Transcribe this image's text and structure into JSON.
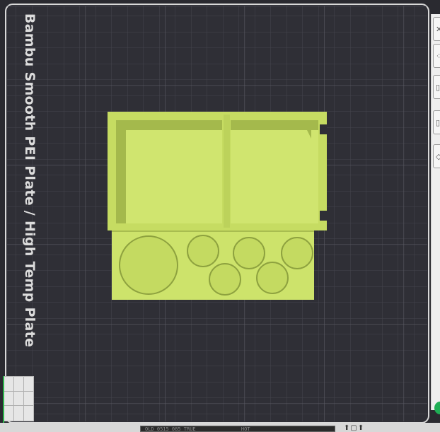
{
  "plate": {
    "label": "Bambu Smooth PEI Plate / High Temp Plate"
  },
  "status_bar": {
    "text": "OLD 0515 085 TRUE",
    "hot_label": "HOT"
  },
  "colors": {
    "background": "#2a2a30",
    "grid_line": "#4a4a52",
    "plate_border": "#d9d9d9",
    "model_fill": "#cde36b",
    "model_shadow": "#9fb44a"
  },
  "icons": {
    "toolbar": [
      "close-icon",
      "arrange-icon",
      "orient-icon",
      "layer-icon",
      "view-icon"
    ]
  }
}
